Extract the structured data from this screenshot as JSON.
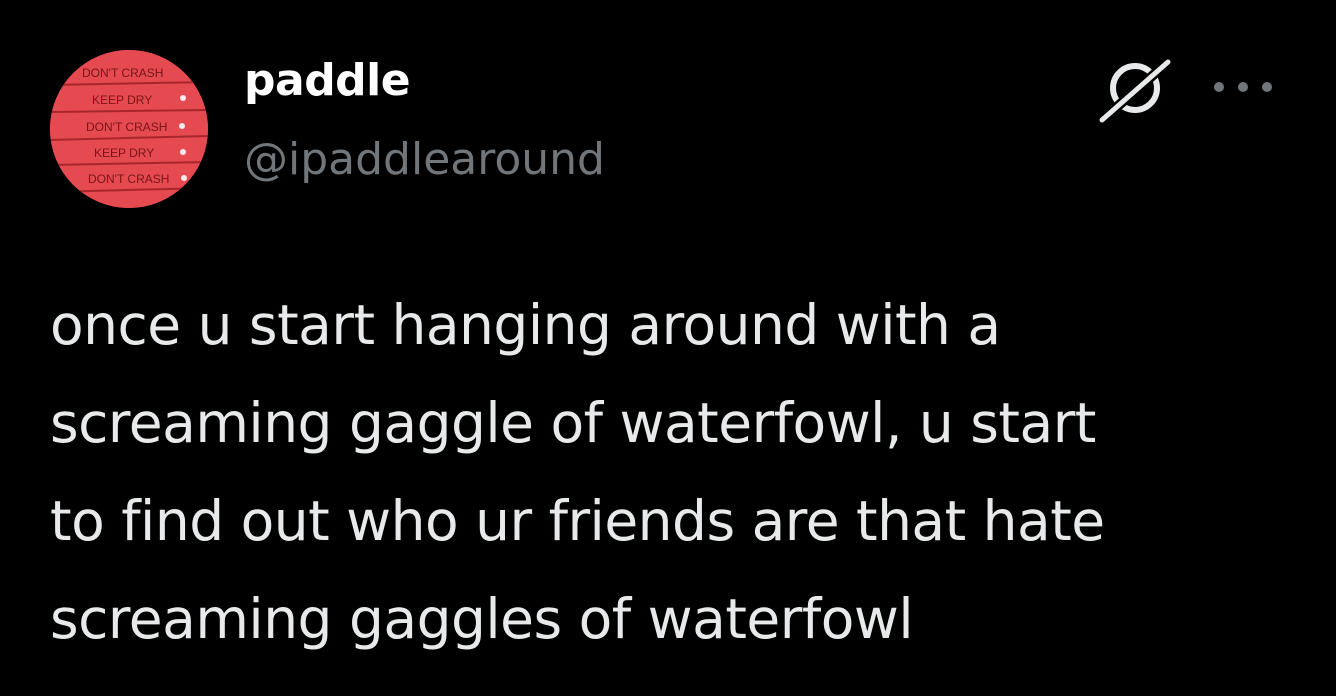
{
  "tweet": {
    "author": {
      "display_name": "paddle",
      "handle": "@ipaddlearound",
      "avatar_label_lines": [
        "DON'T CRASH",
        "KEEP DRY",
        "DON'T CRASH",
        "KEEP DRY",
        "DON'T CRASH"
      ]
    },
    "text": "once u start hanging around with a\nscreaming gaggle of waterfowl, u start\nto find out who ur friends are that hate\nscreaming gaggles of waterfowl",
    "actions": {
      "grok_icon": "grok-icon",
      "more_icon": "more-icon"
    }
  },
  "colors": {
    "background": "#000000",
    "name": "#ffffff",
    "handle": "#71767b",
    "text": "#e7e9ea",
    "avatar": "#e44a4f"
  }
}
